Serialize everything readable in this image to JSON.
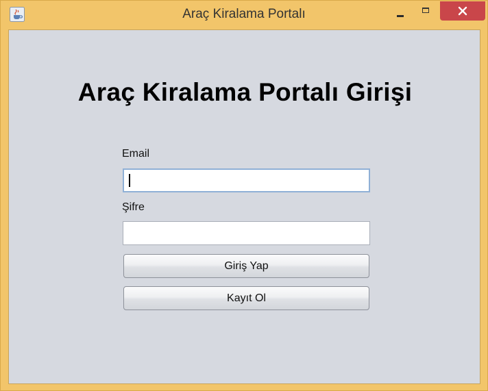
{
  "window": {
    "title": "Araç Kiralama Portalı",
    "icon": "java-cup-icon",
    "controls": [
      "minimize",
      "maximize",
      "close"
    ]
  },
  "form": {
    "heading": "Araç Kiralama Portalı Girişi",
    "email_label": "Email",
    "email_value": "",
    "password_label": "Şifre",
    "password_value": "",
    "login_button": "Giriş Yap",
    "register_button": "Kayıt Ol"
  },
  "colors": {
    "frame": "#f2c56a",
    "client_bg": "#d6d9e0",
    "close_button": "#c9464a",
    "focus_border": "#8fb0d6"
  }
}
